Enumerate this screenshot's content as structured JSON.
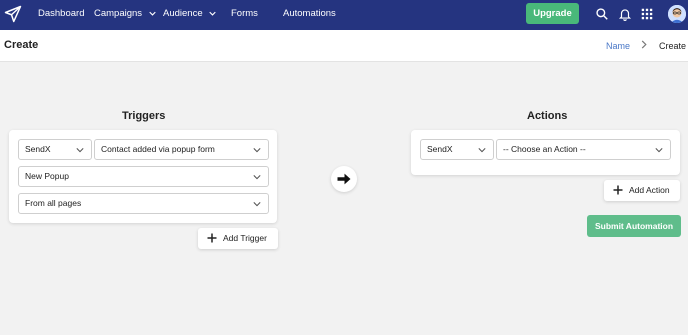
{
  "nav": {
    "items": [
      {
        "label": "Dashboard",
        "has_dropdown": false
      },
      {
        "label": "Campaigns",
        "has_dropdown": true
      },
      {
        "label": "Audience",
        "has_dropdown": true
      },
      {
        "label": "Forms",
        "has_dropdown": false
      },
      {
        "label": "Automations",
        "has_dropdown": false
      }
    ],
    "upgrade_label": "Upgrade",
    "icons": [
      "search-icon",
      "bell-icon",
      "apps-grid-icon"
    ]
  },
  "header": {
    "title": "Create",
    "breadcrumb": {
      "link": "Name",
      "current": "Create"
    }
  },
  "triggers": {
    "title": "Triggers",
    "app_select": "SendX",
    "event_select": "Contact added via popup form",
    "popup_select": "New Popup",
    "pages_select": "From all pages",
    "add_label": "Add Trigger"
  },
  "actions": {
    "title": "Actions",
    "app_select": "SendX",
    "action_select": "-- Choose an Action --",
    "add_label": "Add Action",
    "submit_label": "Submit Automation"
  },
  "colors": {
    "navbar": "#253480",
    "upgrade": "#49b87a",
    "submit": "#5fbd8b",
    "breadcrumb_link": "#4a78c7",
    "background": "#f2f2f2"
  }
}
